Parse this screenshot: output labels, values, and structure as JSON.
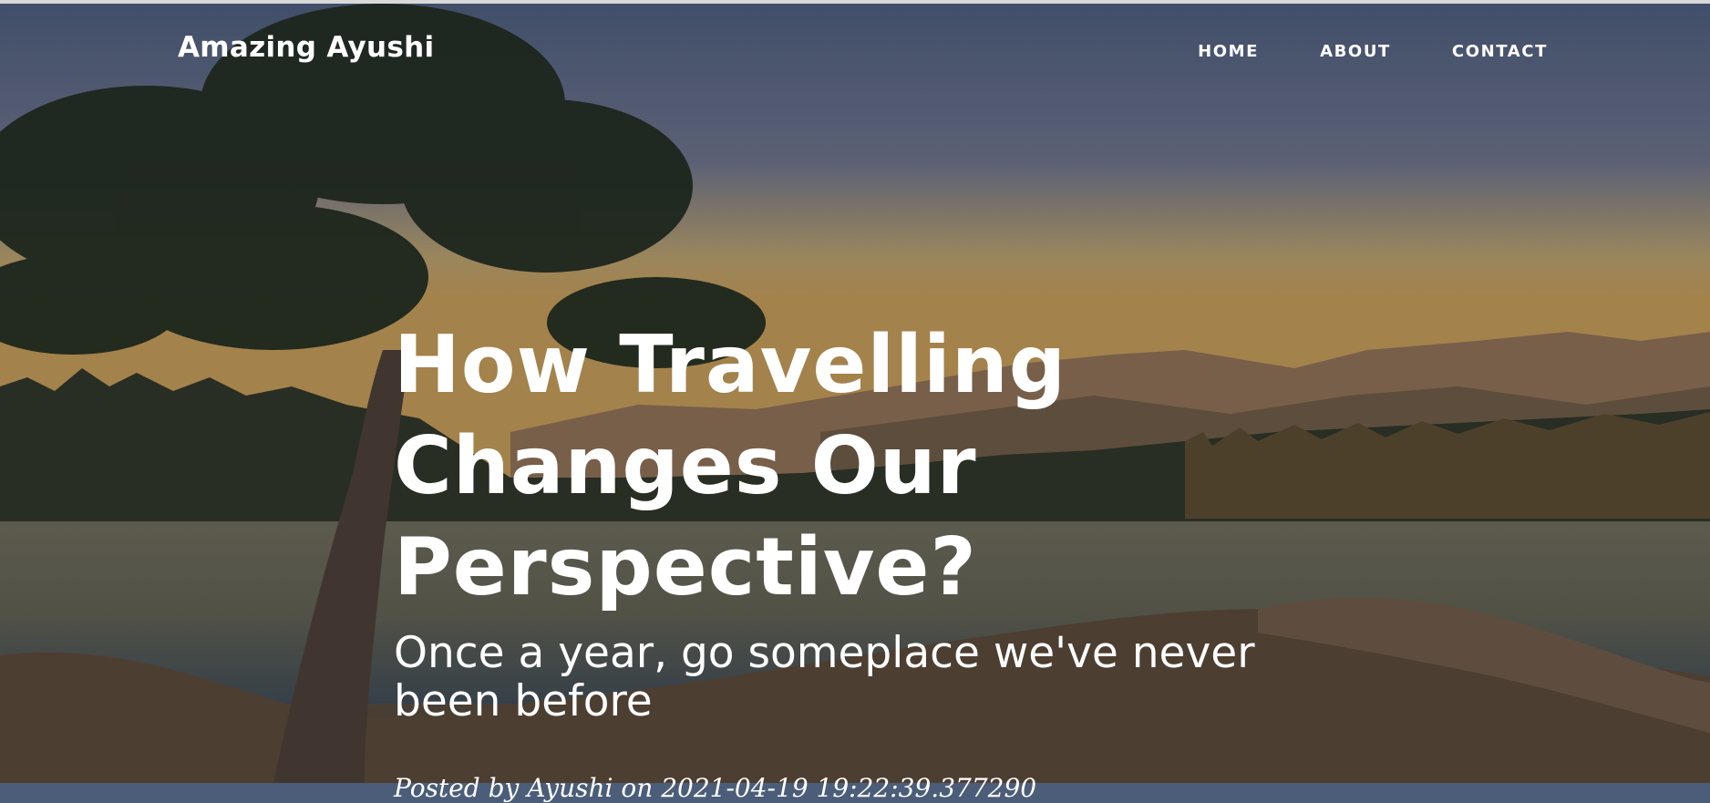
{
  "navbar": {
    "brand": "Amazing Ayushi",
    "links": [
      {
        "label": "HOME"
      },
      {
        "label": "ABOUT"
      },
      {
        "label": "CONTACT"
      }
    ]
  },
  "masthead": {
    "heading": "How Travelling Changes Our Perspective?",
    "subheading": "Once a year, go someplace we've never been before",
    "meta": "Posted by Ayushi on 2021-04-19 19:22:39.377290"
  },
  "theme": {
    "text_color": "#ffffff",
    "overlay": "rgba(20,24,36,0.18)"
  }
}
